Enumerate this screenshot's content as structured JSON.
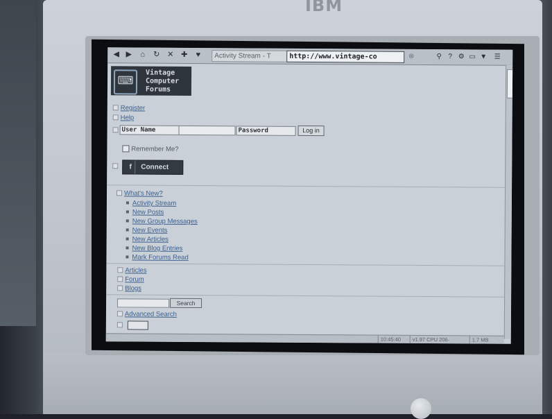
{
  "monitor": {
    "brand": "IBM"
  },
  "browser": {
    "toolbar_icons": [
      "back-arrow-icon",
      "forward-arrow-icon",
      "home-icon",
      "reload-icon",
      "stop-icon",
      "add-icon",
      "bookmark-icon"
    ],
    "page_title": "Activity Stream - T",
    "url": "http://www.vintage-co",
    "right_icons": [
      "search-icon",
      "help-icon",
      "settings-icon",
      "window-icon",
      "download-icon",
      "menu-icon"
    ],
    "status": {
      "time": "10:45:40",
      "version": "v1.97 CPU 206-",
      "extra": "1.7 MB"
    }
  },
  "site": {
    "logo_lines": "Vintage\nComputer\nForums"
  },
  "auth": {
    "register": "Register",
    "help": "Help",
    "username_label": "User Name",
    "password_label": "Password",
    "login_button": "Log in",
    "remember_me": "Remember Me?",
    "connect_button": "Connect"
  },
  "whats_new": {
    "heading": "What's New?",
    "items": [
      "Activity Stream",
      "New Posts",
      "New Group Messages",
      "New Events",
      "New Articles",
      "New Blog Entries",
      "Mark Forums Read"
    ]
  },
  "sections": [
    "Articles",
    "Forum",
    "Blogs"
  ],
  "search": {
    "button": "Search",
    "advanced": "Advanced Search"
  },
  "colors": {
    "screen_bg": "#c9d0d7",
    "link": "#3c5f8e",
    "bezel": "#c4c9cf"
  }
}
